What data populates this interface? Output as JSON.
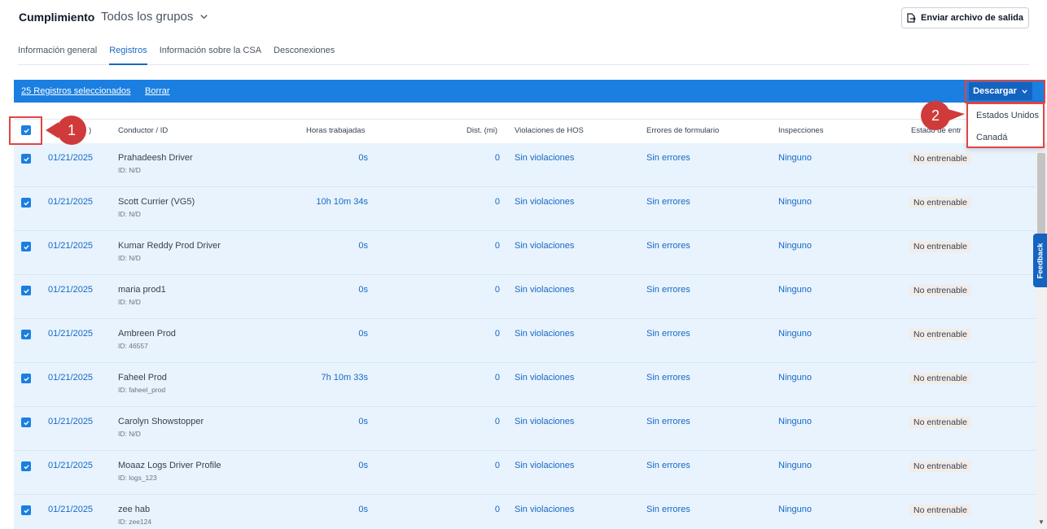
{
  "header": {
    "title": "Cumplimiento",
    "group_selector": "Todos los grupos",
    "send_button_label": "Enviar archivo de salida"
  },
  "tabs": [
    {
      "label": "Información general",
      "active": false
    },
    {
      "label": "Registros",
      "active": true
    },
    {
      "label": "Información sobre la CSA",
      "active": false
    },
    {
      "label": "Desconexiones",
      "active": false
    }
  ],
  "selection_bar": {
    "selected_text": "25 Registros seleccionados",
    "clear_label": "Borrar",
    "download_label": "Descargar"
  },
  "download_menu": {
    "options": [
      "Estados Unidos",
      "Canadá"
    ]
  },
  "table": {
    "columns": {
      "date": ")",
      "driver": "Conductor / ID",
      "hours": "Horas trabajadas",
      "dist": "Dist. (mi)",
      "hos": "Violaciones de HOS",
      "errors": "Errores de formulario",
      "inspections": "Inspecciones",
      "training": "Estado de entr"
    },
    "rows": [
      {
        "date": "01/21/2025",
        "driver": "Prahadeesh Driver",
        "id": "ID: N/D",
        "hours": "0s",
        "dist": "0",
        "hos": "Sin violaciones",
        "errors": "Sin errores",
        "inspections": "Ninguno",
        "training": "No entrenable"
      },
      {
        "date": "01/21/2025",
        "driver": "Scott Currier (VG5)",
        "id": "ID: N/D",
        "hours": "10h 10m 34s",
        "dist": "0",
        "hos": "Sin violaciones",
        "errors": "Sin errores",
        "inspections": "Ninguno",
        "training": "No entrenable"
      },
      {
        "date": "01/21/2025",
        "driver": "Kumar Reddy Prod Driver",
        "id": "ID: N/D",
        "hours": "0s",
        "dist": "0",
        "hos": "Sin violaciones",
        "errors": "Sin errores",
        "inspections": "Ninguno",
        "training": "No entrenable"
      },
      {
        "date": "01/21/2025",
        "driver": "maria prod1",
        "id": "ID: N/D",
        "hours": "0s",
        "dist": "0",
        "hos": "Sin violaciones",
        "errors": "Sin errores",
        "inspections": "Ninguno",
        "training": "No entrenable"
      },
      {
        "date": "01/21/2025",
        "driver": "Ambreen Prod",
        "id": "ID: 46557",
        "hours": "0s",
        "dist": "0",
        "hos": "Sin violaciones",
        "errors": "Sin errores",
        "inspections": "Ninguno",
        "training": "No entrenable"
      },
      {
        "date": "01/21/2025",
        "driver": "Faheel Prod",
        "id": "ID: faheel_prod",
        "hours": "7h 10m 33s",
        "dist": "0",
        "hos": "Sin violaciones",
        "errors": "Sin errores",
        "inspections": "Ninguno",
        "training": "No entrenable"
      },
      {
        "date": "01/21/2025",
        "driver": "Carolyn Showstopper",
        "id": "ID: N/D",
        "hours": "0s",
        "dist": "0",
        "hos": "Sin violaciones",
        "errors": "Sin errores",
        "inspections": "Ninguno",
        "training": "No entrenable"
      },
      {
        "date": "01/21/2025",
        "driver": "Moaaz Logs Driver Profile",
        "id": "ID: logs_123",
        "hours": "0s",
        "dist": "0",
        "hos": "Sin violaciones",
        "errors": "Sin errores",
        "inspections": "Ninguno",
        "training": "No entrenable"
      },
      {
        "date": "01/21/2025",
        "driver": "zee hab",
        "id": "ID: zee124",
        "hours": "0s",
        "dist": "0",
        "hos": "Sin violaciones",
        "errors": "Sin errores",
        "inspections": "Ninguno",
        "training": "No entrenable"
      }
    ]
  },
  "feedback_label": "Feedback",
  "callouts": [
    "1",
    "2"
  ],
  "colors": {
    "accent": "#1a7fe0",
    "link": "#1769c4",
    "row_selected_bg": "#e8f3fd",
    "highlight": "#e04545",
    "callout": "#d03a3a"
  }
}
